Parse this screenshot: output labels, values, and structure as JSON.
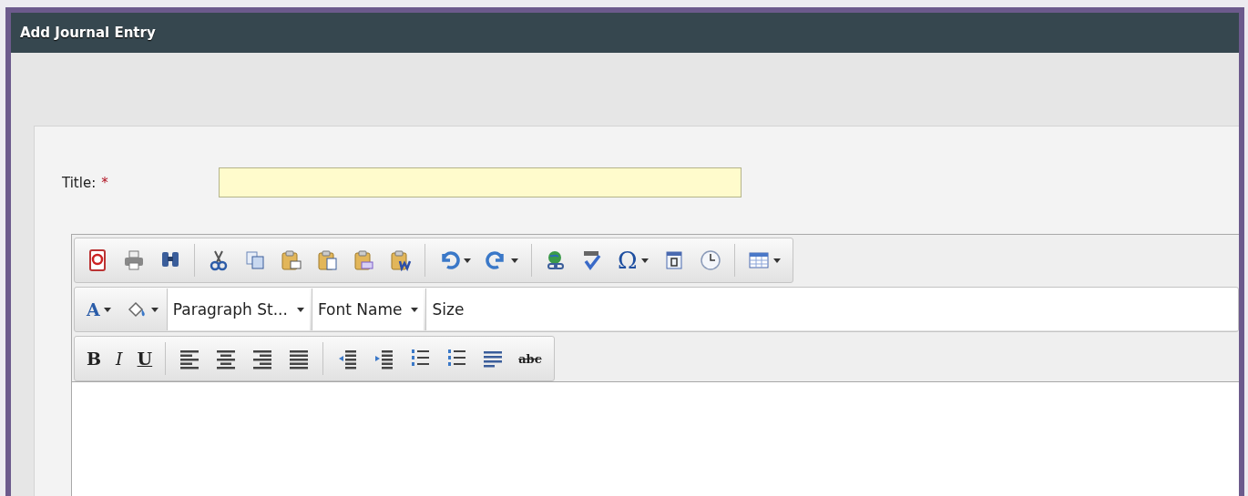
{
  "window": {
    "title": "Add Journal Entry"
  },
  "form": {
    "title_label": "Title:",
    "required_mark": "*"
  },
  "editor": {
    "toolbar_rows": [
      [
        [
          {
            "kind": "pdf"
          },
          {
            "kind": "print"
          },
          {
            "kind": "find"
          }
        ],
        [
          {
            "kind": "cut"
          },
          {
            "kind": "copy"
          },
          {
            "kind": "paste"
          },
          {
            "kind": "paste-text"
          },
          {
            "kind": "paste-html"
          },
          {
            "kind": "paste-word"
          }
        ],
        [
          {
            "kind": "undo",
            "dropdown": true
          },
          {
            "kind": "redo",
            "dropdown": true
          }
        ],
        [
          {
            "kind": "link"
          },
          {
            "kind": "spellcheck"
          },
          {
            "kind": "symbol",
            "label": "Ω",
            "dropdown": true
          },
          {
            "kind": "calendar"
          },
          {
            "kind": "clock"
          }
        ],
        [
          {
            "kind": "table",
            "dropdown": true
          }
        ]
      ],
      [
        [
          {
            "kind": "font-color",
            "label": "A",
            "dropdown": true
          },
          {
            "kind": "highlight",
            "dropdown": true
          },
          {
            "kind": "select",
            "label": "Paragraph St...",
            "dropdown": true
          },
          {
            "kind": "select",
            "label": "Font Name",
            "dropdown": true
          },
          {
            "kind": "wide-select",
            "label": "Size"
          }
        ]
      ],
      [
        [
          {
            "kind": "bold",
            "label": "B"
          },
          {
            "kind": "italic",
            "label": "I"
          },
          {
            "kind": "underline",
            "label": "U"
          }
        ],
        [
          {
            "kind": "align-left"
          },
          {
            "kind": "align-center"
          },
          {
            "kind": "align-right"
          },
          {
            "kind": "justify"
          }
        ],
        [
          {
            "kind": "outdent"
          },
          {
            "kind": "indent"
          },
          {
            "kind": "ordered-list"
          },
          {
            "kind": "bullet-list"
          },
          {
            "kind": "paragraph"
          },
          {
            "kind": "strikethrough",
            "label": "abc"
          }
        ]
      ]
    ]
  }
}
